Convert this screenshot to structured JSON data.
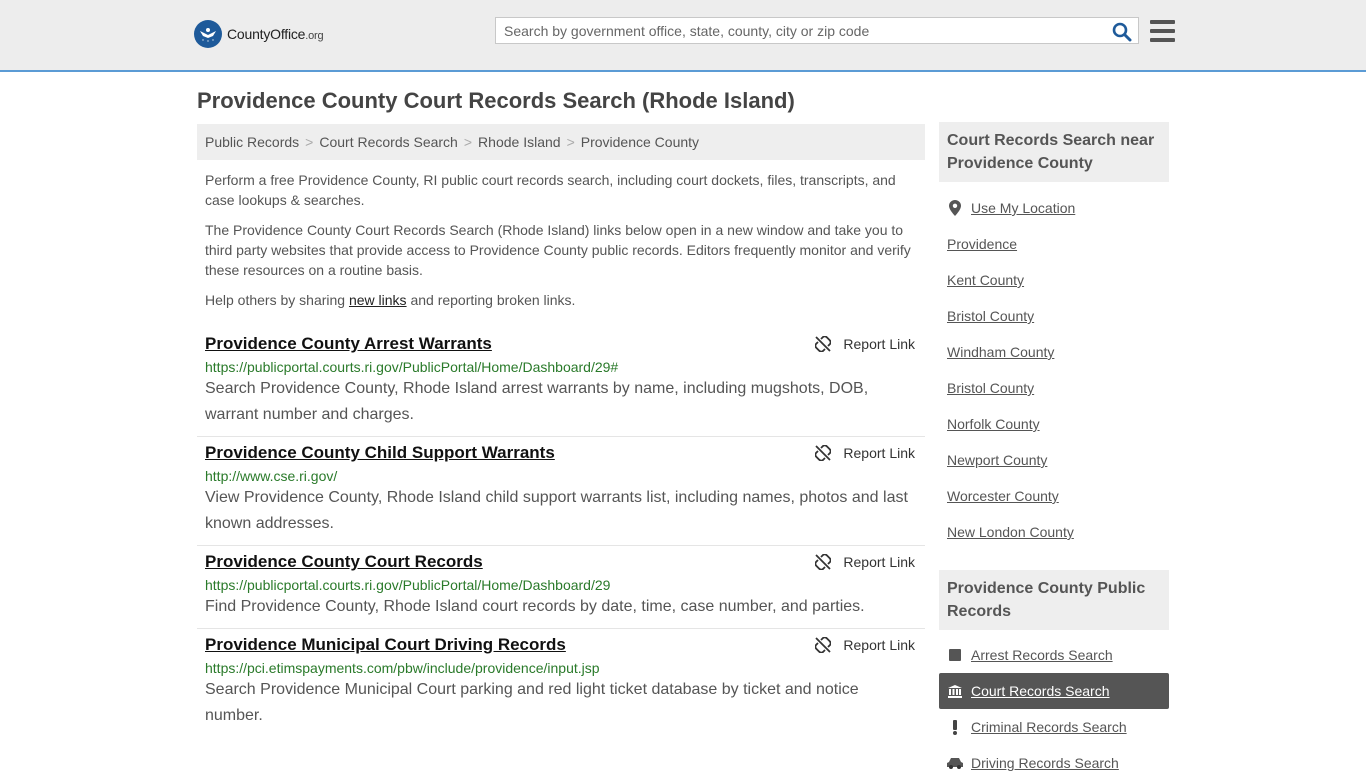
{
  "header": {
    "logo_name": "CountyOffice",
    "logo_tld": ".org",
    "search_placeholder": "Search by government office, state, county, city or zip code"
  },
  "page_title": "Providence County Court Records Search (Rhode Island)",
  "breadcrumb": [
    "Public Records",
    "Court Records Search",
    "Rhode Island",
    "Providence County"
  ],
  "intro": {
    "p1": "Perform a free Providence County, RI public court records search, including court dockets, files, transcripts, and case lookups & searches.",
    "p2": "The Providence County Court Records Search (Rhode Island) links below open in a new window and take you to third party websites that provide access to Providence County public records. Editors frequently monitor and verify these resources on a routine basis.",
    "p3_before": "Help others by sharing ",
    "p3_link": "new links",
    "p3_after": " and reporting broken links."
  },
  "report_label": "Report Link",
  "results": [
    {
      "title": "Providence County Arrest Warrants",
      "url": "https://publicportal.courts.ri.gov/PublicPortal/Home/Dashboard/29#",
      "desc": "Search Providence County, Rhode Island arrest warrants by name, including mugshots, DOB, warrant number and charges."
    },
    {
      "title": "Providence County Child Support Warrants",
      "url": "http://www.cse.ri.gov/",
      "desc": "View Providence County, Rhode Island child support warrants list, including names, photos and last known addresses."
    },
    {
      "title": "Providence County Court Records",
      "url": "https://publicportal.courts.ri.gov/PublicPortal/Home/Dashboard/29",
      "desc": "Find Providence County, Rhode Island court records by date, time, case number, and parties."
    },
    {
      "title": "Providence Municipal Court Driving Records",
      "url": "https://pci.etimspayments.com/pbw/include/providence/input.jsp",
      "desc": "Search Providence Municipal Court parking and red light ticket database by ticket and notice number."
    }
  ],
  "sidebar": {
    "nearby_heading": "Court Records Search near Providence County",
    "use_location": "Use My Location",
    "nearby": [
      "Providence",
      "Kent County",
      "Bristol County",
      "Windham County",
      "Bristol County",
      "Norfolk County",
      "Newport County",
      "Worcester County",
      "New London County"
    ],
    "public_heading": "Providence County Public Records",
    "public": [
      {
        "label": "Arrest Records Search",
        "icon": "square-icon"
      },
      {
        "label": "Court Records Search",
        "icon": "courthouse-icon",
        "active": true
      },
      {
        "label": "Criminal Records Search",
        "icon": "exclamation-icon"
      },
      {
        "label": "Driving Records Search",
        "icon": "car-icon"
      }
    ]
  },
  "colors": {
    "header_bg": "#ededed",
    "header_border": "#5b9bd5",
    "url_green": "#2a7a2a",
    "active_bg": "#555555",
    "logo_blue": "#1e5a9a"
  }
}
